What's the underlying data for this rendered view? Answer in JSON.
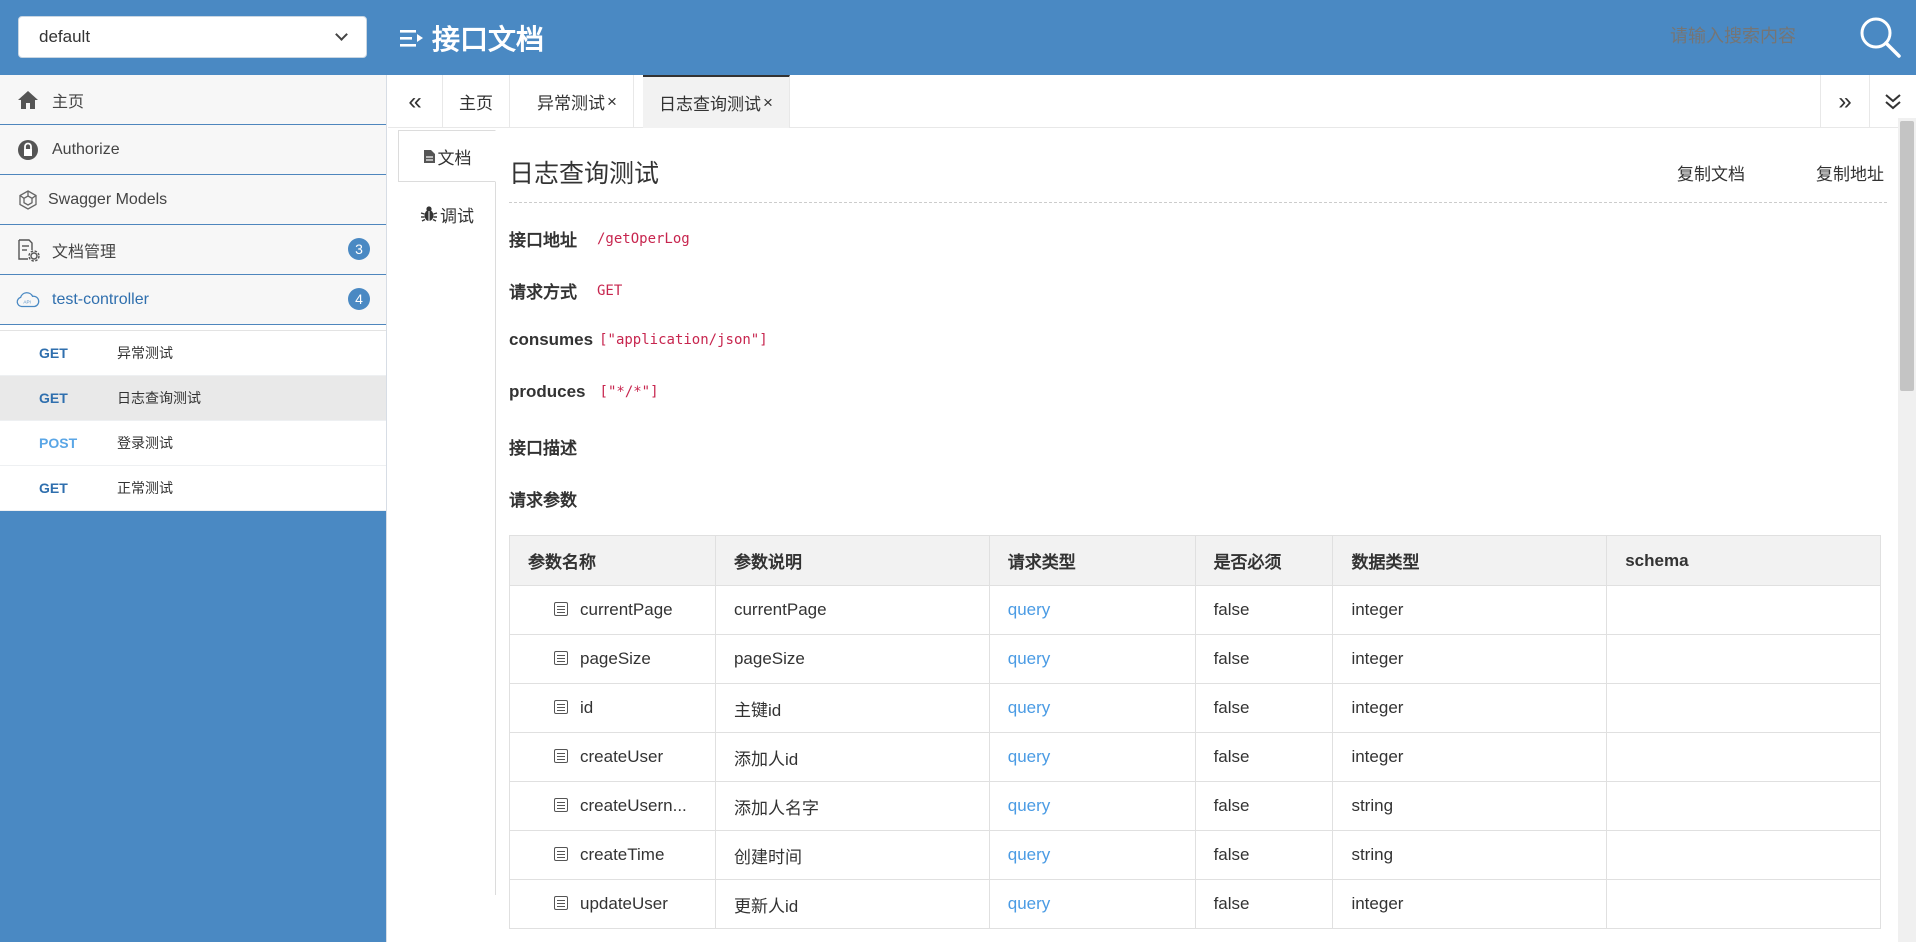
{
  "header": {
    "group_select": "default",
    "title": "接口文档",
    "search_placeholder": "请输入搜索内容"
  },
  "sidebar": {
    "menu": [
      {
        "label": "主页",
        "icon": "home-icon"
      },
      {
        "label": "Authorize",
        "icon": "lock-icon"
      },
      {
        "label": "Swagger Models",
        "icon": "models-icon"
      },
      {
        "label": "文档管理",
        "icon": "doc-settings-icon",
        "badge": "3"
      },
      {
        "label": "test-controller",
        "icon": "cloud-api-icon",
        "badge": "4"
      }
    ],
    "apis": [
      {
        "method": "GET",
        "name": "异常测试"
      },
      {
        "method": "GET",
        "name": "日志查询测试"
      },
      {
        "method": "POST",
        "name": "登录测试"
      },
      {
        "method": "GET",
        "name": "正常测试"
      }
    ]
  },
  "tabs": {
    "prev": "«",
    "items": [
      "主页",
      "异常测试",
      "日志查询测试"
    ],
    "close": "×",
    "next": "»"
  },
  "doc_tabs": {
    "doc": "文档",
    "debug": "调试"
  },
  "doc": {
    "title": "日志查询测试",
    "copy_doc": "复制文档",
    "copy_url": "复制地址",
    "fields": [
      {
        "key": "接口地址",
        "value": "/getOperLog"
      },
      {
        "key": "请求方式",
        "value": "GET"
      },
      {
        "key": "consumes",
        "value": "[\"application/json\"]"
      },
      {
        "key": "produces",
        "value": "[\"*/*\"]"
      },
      {
        "key": "接口描述",
        "value": ""
      },
      {
        "key": "请求参数",
        "value": ""
      }
    ],
    "table": {
      "headers": [
        "参数名称",
        "参数说明",
        "请求类型",
        "是否必须",
        "数据类型",
        "schema"
      ],
      "rows": [
        [
          "currentPage",
          "currentPage",
          "query",
          "false",
          "integer",
          ""
        ],
        [
          "pageSize",
          "pageSize",
          "query",
          "false",
          "integer",
          ""
        ],
        [
          "id",
          "主键id",
          "query",
          "false",
          "integer",
          ""
        ],
        [
          "createUser",
          "添加人id",
          "query",
          "false",
          "integer",
          ""
        ],
        [
          "createUsern...",
          "添加人名字",
          "query",
          "false",
          "string",
          ""
        ],
        [
          "createTime",
          "创建时间",
          "query",
          "false",
          "string",
          ""
        ],
        [
          "updateUser",
          "更新人id",
          "query",
          "false",
          "integer",
          ""
        ]
      ]
    }
  }
}
